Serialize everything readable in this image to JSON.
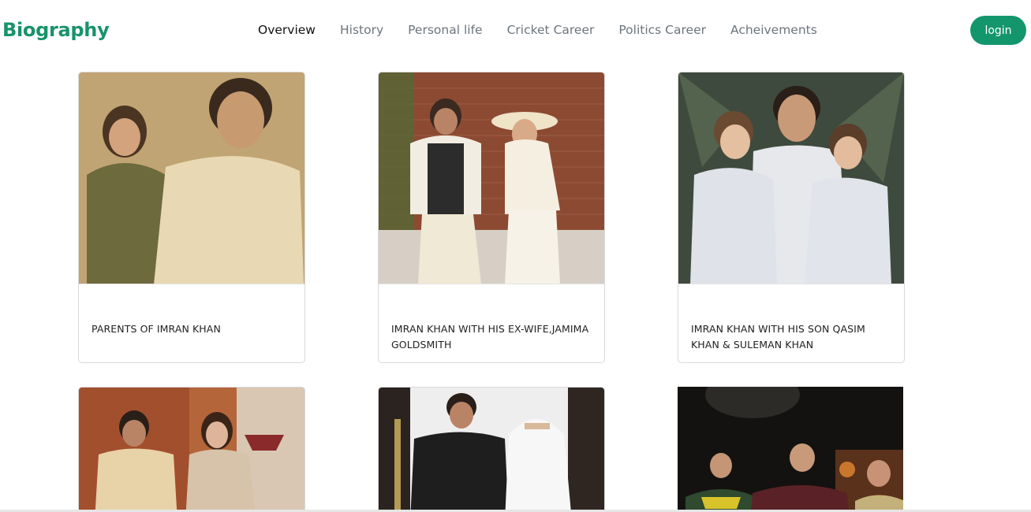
{
  "brand": "Biography",
  "nav": {
    "links": [
      "Overview",
      "History",
      "Personal life",
      "Cricket Career",
      "Politics Career",
      "Acheivements"
    ],
    "login": "login"
  },
  "cards": [
    {
      "caption": "PARENTS OF IMRAN KHAN"
    },
    {
      "caption": "IMRAN KHAN WITH HIS EX-WIFE,JAMIMA GOLDSMITH"
    },
    {
      "caption": "IMRAN KHAN WITH HIS SON QASIM KHAN & SULEMAN KHAN"
    },
    {
      "caption": ""
    },
    {
      "caption": ""
    },
    {
      "caption": ""
    }
  ],
  "colors": {
    "brand": "#17936a",
    "button": "#13966c",
    "nav_inactive": "#6c757d"
  }
}
